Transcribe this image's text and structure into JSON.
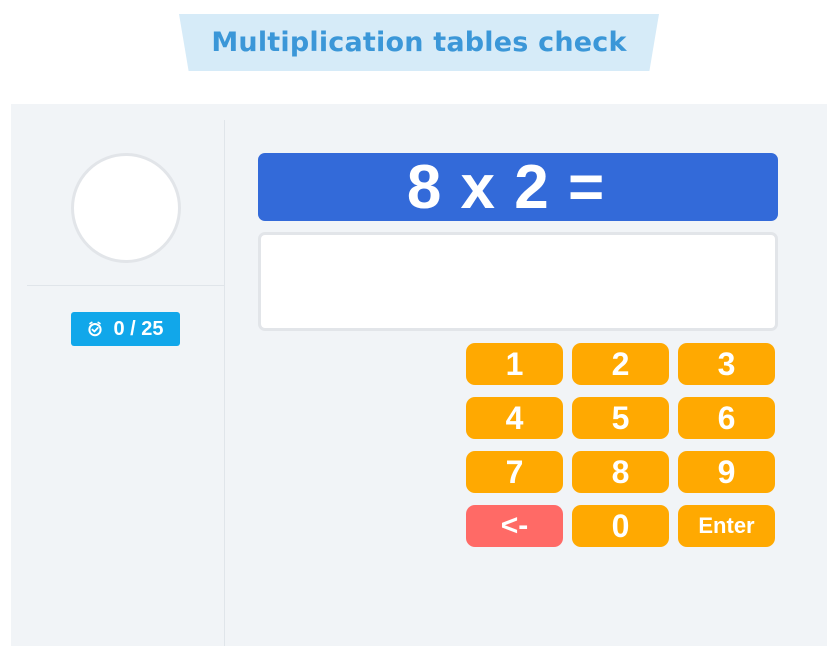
{
  "page": {
    "title": "Multiplication tables check"
  },
  "sidebar": {
    "score": "0 / 25",
    "score_icon": "timer-icon",
    "colors": {
      "badge": "#11a7ea",
      "panel": "#f1f4f7"
    }
  },
  "question": {
    "text": "8 x 2 =",
    "color": "#336ad9"
  },
  "answer": {
    "value": ""
  },
  "keypad": {
    "colors": {
      "digit": "#ffa901",
      "backspace": "#ff6a66"
    },
    "keys": [
      {
        "label": "1",
        "action": "digit"
      },
      {
        "label": "2",
        "action": "digit"
      },
      {
        "label": "3",
        "action": "digit"
      },
      {
        "label": "4",
        "action": "digit"
      },
      {
        "label": "5",
        "action": "digit"
      },
      {
        "label": "6",
        "action": "digit"
      },
      {
        "label": "7",
        "action": "digit"
      },
      {
        "label": "8",
        "action": "digit"
      },
      {
        "label": "9",
        "action": "digit"
      },
      {
        "label": "<-",
        "action": "backspace"
      },
      {
        "label": "0",
        "action": "digit"
      },
      {
        "label": "Enter",
        "action": "enter"
      }
    ]
  }
}
